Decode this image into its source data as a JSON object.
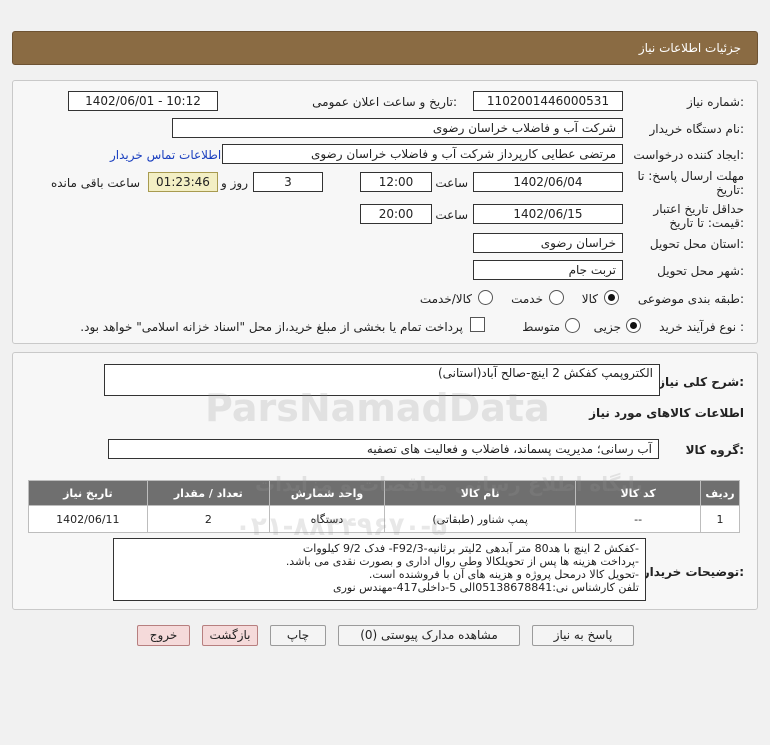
{
  "header": {
    "title": "جزئیات اطلاعات نیاز"
  },
  "fields": {
    "need_number_label": "شماره نیاز:",
    "need_number": "1102001446000531",
    "announce_label": "تاریخ و ساعت اعلان عمومی:",
    "announce_value": "1402/06/01 - 10:12",
    "buyer_org_label": "نام دستگاه خریدار:",
    "buyer_org": "شرکت آب و فاضلاب خراسان رضوی",
    "creator_label": "ایجاد کننده درخواست:",
    "creator": "مرتضی عطایی کارپرداز شرکت آب و فاضلاب خراسان رضوی",
    "contact_link": "اطلاعات تماس خریدار",
    "deadline_label_1": "مهلت ارسال پاسخ: تا",
    "deadline_label_2": "تاریخ:",
    "deadline_date": "1402/06/04",
    "time_label": "ساعت",
    "deadline_time": "12:00",
    "days_value": "3",
    "days_label": "روز و",
    "remaining_time": "01:23:46",
    "remaining_label": "ساعت باقی مانده",
    "validity_label_1": "حداقل تاریخ اعتبار",
    "validity_label_2": "قیمت: تا تاریخ:",
    "validity_date": "1402/06/15",
    "validity_time_label": "ساعت",
    "validity_time": "20:00",
    "province_label": "استان محل تحویل:",
    "province": "خراسان رضوی",
    "city_label": "شهر محل تحویل:",
    "city": "تربت جام",
    "category_label": "طبقه بندی موضوعی:",
    "category_options": [
      "کالا",
      "خدمت",
      "کالا/خدمت"
    ],
    "process_label": "نوع فرآیند خرید :",
    "process_options": [
      "جزیی",
      "متوسط"
    ],
    "payment_note": "پرداخت تمام یا بخشی از مبلغ خرید،از محل \"اسناد خزانه اسلامی\" خواهد بود."
  },
  "summary": {
    "label": "شرح کلی نیاز:",
    "value": "الکتروپمپ کفکش 2 اینچ-صالح آباد(استانی)"
  },
  "goods": {
    "section_title": "اطلاعات کالاهای مورد نیاز",
    "group_label": "گروه کالا:",
    "group_value": "آب رسانی؛ مدیریت پسماند، فاضلاب و فعالیت های تصفیه",
    "columns": [
      "ردیف",
      "کد کالا",
      "نام کالا",
      "واحد شمارش",
      "تعداد / مقدار",
      "تاریخ نیاز"
    ],
    "rows": [
      {
        "row": "1",
        "code": "--",
        "name": "پمپ شناور (طبقاتی)",
        "unit": "دستگاه",
        "qty": "2",
        "date": "1402/06/11"
      }
    ]
  },
  "buyer_notes": {
    "label": "توضیحات خریدار:",
    "lines": [
      "-کفکش 2 اینچ با هد80 متر آبدهی 2لیتر برثانیه-F92/3- فدک 9/2 کیلووات",
      "-پرداخت هزینه ها پس از تحویلکالا وطی روال اداری و بصورت نقدی می باشد.",
      "-تحویل کالا درمحل پروژه و هزینه های آن با فروشنده است.",
      "تلفن کارشناس نی:05138678841الی 5-داخلی417-مهندس نوری"
    ]
  },
  "buttons": {
    "reply": "پاسخ به نیاز",
    "attachments": "مشاهده مدارک پیوستی (0)",
    "print": "چاپ",
    "back": "بازگشت",
    "exit": "خروج"
  },
  "watermark": {
    "brand": "ParsNamadData",
    "tagline": "پایگاه اطلاع رسانی مناقصات و مزایدات",
    "phone": "۰۲۱-۸۸۳۴۹۶۷۰-۵"
  },
  "colors": {
    "header": "#8a6b43",
    "table_header": "#6f6f6f",
    "link": "#1a3fbf",
    "timer": "#f3efc4"
  }
}
